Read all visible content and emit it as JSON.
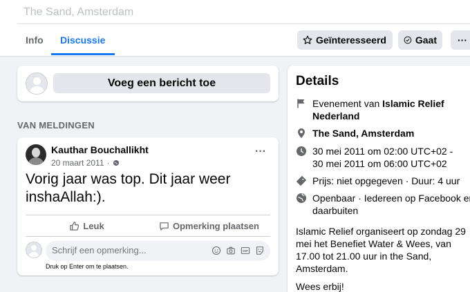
{
  "header": {
    "location_title": "The Sand, Amsterdam",
    "tabs": [
      {
        "label": "Info",
        "active": false
      },
      {
        "label": "Discussie",
        "active": true
      }
    ],
    "buttons": {
      "interested": "Geïnteresseerd",
      "going": "Gaat",
      "more": "···"
    }
  },
  "compose": {
    "button_label": "Voeg een bericht toe"
  },
  "section_label": "VAN MELDINGEN",
  "post": {
    "author": "Kauthar Bouchallikht",
    "date": "20 maart 2011",
    "separator": "·",
    "more": "···",
    "text": "Vorig jaar was top. Dit jaar weer inshaAllah:).",
    "like_label": "Leuk",
    "comment_label": "Opmerking plaatsen",
    "comment_placeholder": "Schrijf een opmerking...",
    "enter_hint": "Druk op Enter om te plaatsen."
  },
  "details": {
    "title": "Details",
    "organizer_prefix": "Evenement van ",
    "organizer": "Islamic Relief Nederland",
    "location": "The Sand, Amsterdam",
    "time_start": "30 mei 2011 om 02:00 UTC+02 -",
    "time_end": "30 mei 2011 om 06:00 UTC+02",
    "price": "Prijs: niet opgegeven · Duur: 4 uur",
    "visibility": "Openbaar · Iedereen op Facebook en daarbuiten",
    "description": "Islamic Relief organiseert op zondag 29 mei het Benefiet Water & Wees, van 17.00 tot 21.00 uur in the Sand, Amsterdam.",
    "cta": "Wees erbij!"
  },
  "colors": {
    "accent": "#1877f2",
    "background": "#f0f2f5",
    "secondary_text": "#65676b",
    "button_bg": "#e4e6eb"
  }
}
